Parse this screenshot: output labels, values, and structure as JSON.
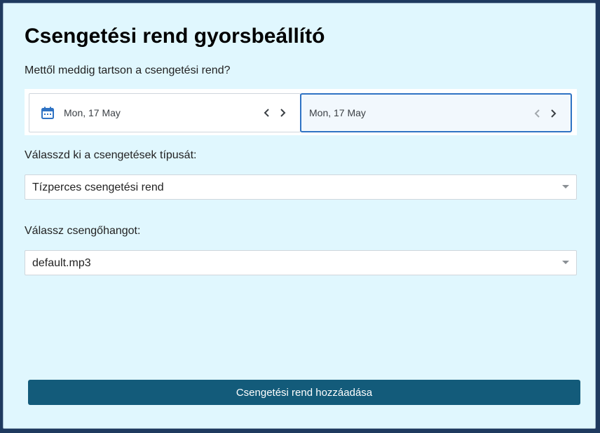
{
  "dialog": {
    "title": "Csengetési rend gyorsbeállító",
    "range_label": "Mettől meddig tartson a csengetési rend?",
    "date_from": "Mon, 17 May",
    "date_to": "Mon, 17 May",
    "type_label": "Válasszd ki a csengetések típusát:",
    "type_value": "Tízperces csengetési rend",
    "sound_label": "Válassz csengőhangot:",
    "sound_value": "default.mp3",
    "submit_label": "Csengetési rend hozzáadása"
  },
  "colors": {
    "background": "#e0f7fe",
    "accent": "#2f73c4",
    "button": "#135b7a",
    "calendar_icon": "#2f73c4"
  },
  "icons": [
    "calendar-icon",
    "chevron-left-icon",
    "chevron-right-icon",
    "dropdown-caret-icon"
  ]
}
